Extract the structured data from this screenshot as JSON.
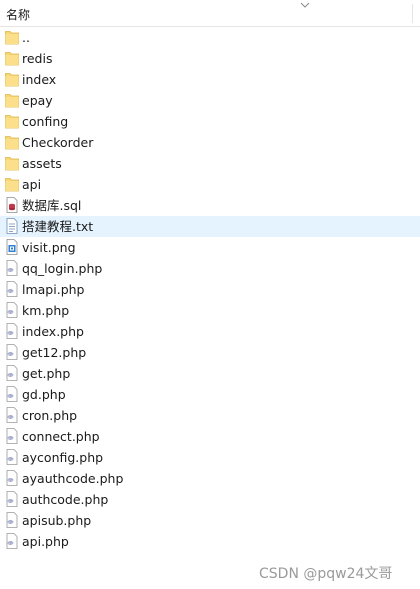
{
  "header": {
    "column_name": "名称"
  },
  "files": [
    {
      "name": "..",
      "icon": "folder-icon"
    },
    {
      "name": "redis",
      "icon": "folder-icon"
    },
    {
      "name": "index",
      "icon": "folder-icon"
    },
    {
      "name": "epay",
      "icon": "folder-icon"
    },
    {
      "name": "confing",
      "icon": "folder-icon"
    },
    {
      "name": "Checkorder",
      "icon": "folder-icon"
    },
    {
      "name": "assets",
      "icon": "folder-icon"
    },
    {
      "name": "api",
      "icon": "folder-icon"
    },
    {
      "name": "数据库.sql",
      "icon": "sql-file-icon"
    },
    {
      "name": "搭建教程.txt",
      "icon": "text-file-icon",
      "selected": true
    },
    {
      "name": "visit.png",
      "icon": "image-file-icon"
    },
    {
      "name": "qq_login.php",
      "icon": "php-file-icon"
    },
    {
      "name": "lmapi.php",
      "icon": "php-file-icon"
    },
    {
      "name": "km.php",
      "icon": "php-file-icon"
    },
    {
      "name": "index.php",
      "icon": "php-file-icon"
    },
    {
      "name": "get12.php",
      "icon": "php-file-icon"
    },
    {
      "name": "get.php",
      "icon": "php-file-icon"
    },
    {
      "name": "gd.php",
      "icon": "php-file-icon"
    },
    {
      "name": "cron.php",
      "icon": "php-file-icon"
    },
    {
      "name": "connect.php",
      "icon": "php-file-icon"
    },
    {
      "name": "ayconfig.php",
      "icon": "php-file-icon"
    },
    {
      "name": "ayauthcode.php",
      "icon": "php-file-icon"
    },
    {
      "name": "authcode.php",
      "icon": "php-file-icon"
    },
    {
      "name": "apisub.php",
      "icon": "php-file-icon"
    },
    {
      "name": "api.php",
      "icon": "php-file-icon"
    }
  ],
  "watermark": "CSDN @pqw24文哥",
  "colors": {
    "folder": "#f8d775",
    "selected_row": "#e5f3ff",
    "watermark": "#9a9a9a"
  }
}
